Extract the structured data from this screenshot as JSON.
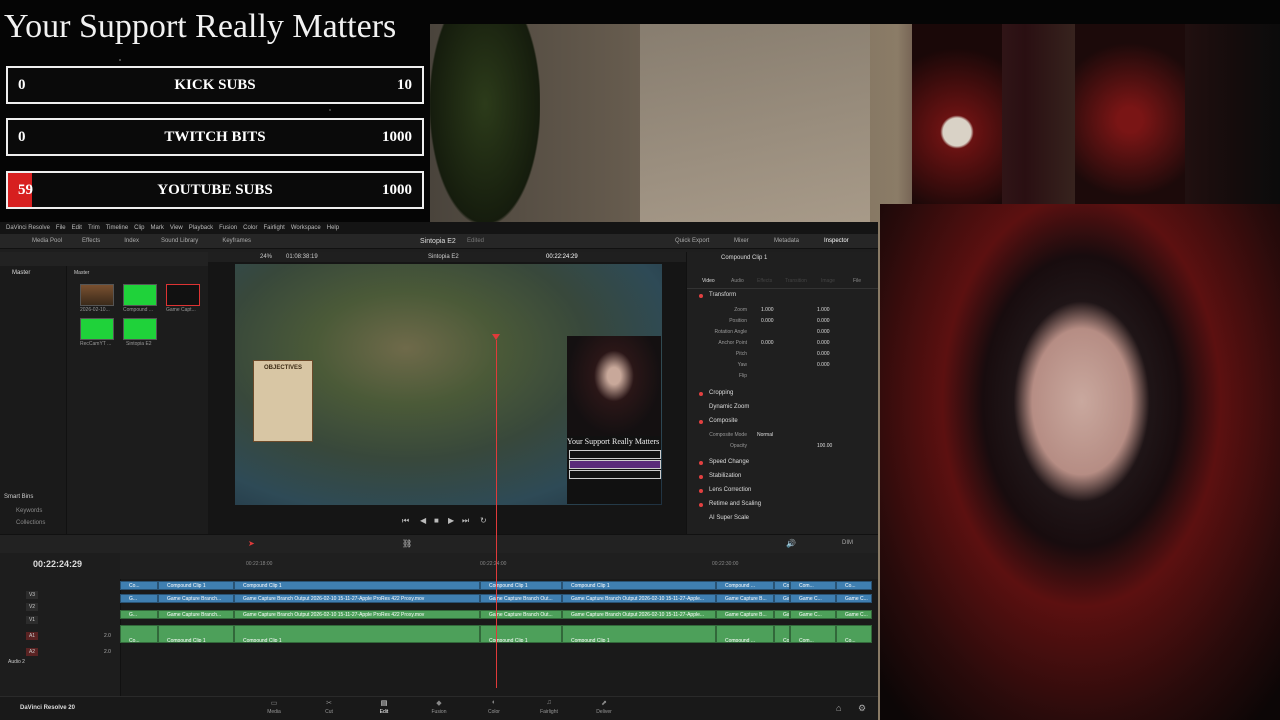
{
  "overlay": {
    "title": "Your Support Really Matters",
    "goals": [
      {
        "left": "0",
        "label": "KICK SUBS",
        "right": "10",
        "progress": 0
      },
      {
        "left": "0",
        "label": "TWITCH BITS",
        "right": "1000",
        "progress": 0
      },
      {
        "left": "59",
        "label": "YOUTUBE SUBS",
        "right": "1000",
        "progress": 0.059
      }
    ],
    "accent": "#d71f1f"
  },
  "resolve": {
    "menu": [
      "DaVinci Resolve",
      "File",
      "Edit",
      "Trim",
      "Timeline",
      "Clip",
      "Mark",
      "View",
      "Playback",
      "Fusion",
      "Color",
      "Fairlight",
      "Workspace",
      "Help"
    ],
    "toolbar_left": [
      "Media Pool",
      "Effects",
      "Index",
      "Sound Library",
      "Keyframes"
    ],
    "project_title": "Sintopia E2",
    "project_status": "Edited",
    "toolbar_right": [
      "Quick Export",
      "Mixer",
      "Metadata",
      "Inspector"
    ],
    "media_pool": {
      "bin_header": "Master",
      "header": "Master",
      "items": [
        "2026-02-10...",
        "Compound ...",
        "Game Capt...",
        "RecCamYT ...",
        "Sintopia E2"
      ],
      "smart_bins": "Smart Bins",
      "smart_items": [
        "Keywords",
        "Collections"
      ]
    },
    "viewer": {
      "zoom": "24%",
      "duration": "01:08:38:19",
      "clip_name": "Sintopia E2",
      "timecode": "00:22:24:29",
      "objectives": "OBJECTIVES",
      "mini_title": "Your Support Really Matters"
    },
    "inspector": {
      "title": "Compound Clip 1",
      "tabs": [
        "Video",
        "Audio",
        "Effects",
        "Transition",
        "Image",
        "File"
      ],
      "sections": [
        "Transform",
        "Cropping",
        "Dynamic Zoom",
        "Composite",
        "Speed Change",
        "Stabilization",
        "Lens Correction",
        "Retime and Scaling",
        "AI Super Scale"
      ],
      "props": {
        "zoom": {
          "label": "Zoom",
          "x": "1.000",
          "y": "1.000"
        },
        "position": {
          "label": "Position",
          "x": "0.000",
          "y": "0.000"
        },
        "rotation": {
          "label": "Rotation Angle",
          "v": "0.000"
        },
        "anchor": {
          "label": "Anchor Point",
          "x": "0.000",
          "y": "0.000"
        },
        "pitch": {
          "label": "Pitch",
          "v": "0.000"
        },
        "yaw": {
          "label": "Yaw",
          "v": "0.000"
        },
        "flip": {
          "label": "Flip"
        },
        "composite_mode": {
          "label": "Composite Mode",
          "v": "Normal"
        },
        "opacity": {
          "label": "Opacity",
          "v": "100.00"
        }
      }
    },
    "timeline": {
      "timecode": "00:22:24:29",
      "ruler": [
        "00:22:18:00",
        "00:22:24:00",
        "00:22:30:00"
      ],
      "tracks": [
        "V3",
        "V2",
        "V1",
        "A1",
        "A2"
      ],
      "track_values": [
        "2.0",
        "2.0"
      ],
      "audio_label": "Audio 2",
      "dim": "DIM",
      "v2_clips": [
        "Co...",
        "Compound Clip 1",
        "Compound Clip 1",
        "Compound Clip 1",
        "Compound Clip 1",
        "Compound ...",
        "Co...",
        "Com...",
        "Co..."
      ],
      "v1_clips": [
        "G...",
        "Game Capture Branch...",
        "Game Capture Branch Output 2026-02-10 15-11-27-Apple ProRes 422 Proxy.mov",
        "Game Capture Branch Out...",
        "Game Capture Branch Output 2026-02-10 15-11-27-Apple...",
        "Game Capture B...",
        "Ga...",
        "Game C...",
        "Game C..."
      ],
      "a1_clips": [
        "G...",
        "Game Capture Branch...",
        "Game Capture Branch Output 2026-02-10 15-11-27-Apple ProRes 422 Proxy.mov",
        "Game Capture Branch Out...",
        "Game Capture Branch Output 2026-02-10 15-11-27-Apple...",
        "Game Capture B...",
        "Ga...",
        "Game C...",
        "Game C..."
      ],
      "a2_clips": [
        "Co...",
        "Compound Clip 1",
        "Compound Clip 1",
        "Compound Clip 1",
        "Compound Clip 1",
        "Compound ...",
        "Co...",
        "Com...",
        "Co..."
      ]
    },
    "pages": [
      "Media",
      "Cut",
      "Edit",
      "Fusion",
      "Color",
      "Fairlight",
      "Deliver"
    ],
    "active_page": "Edit",
    "brand": "DaVinci Resolve 20",
    "colors": {
      "video_clip": "#3f7fb1",
      "audio_clip": "#4da05a",
      "playhead": "#e03a3a"
    }
  }
}
